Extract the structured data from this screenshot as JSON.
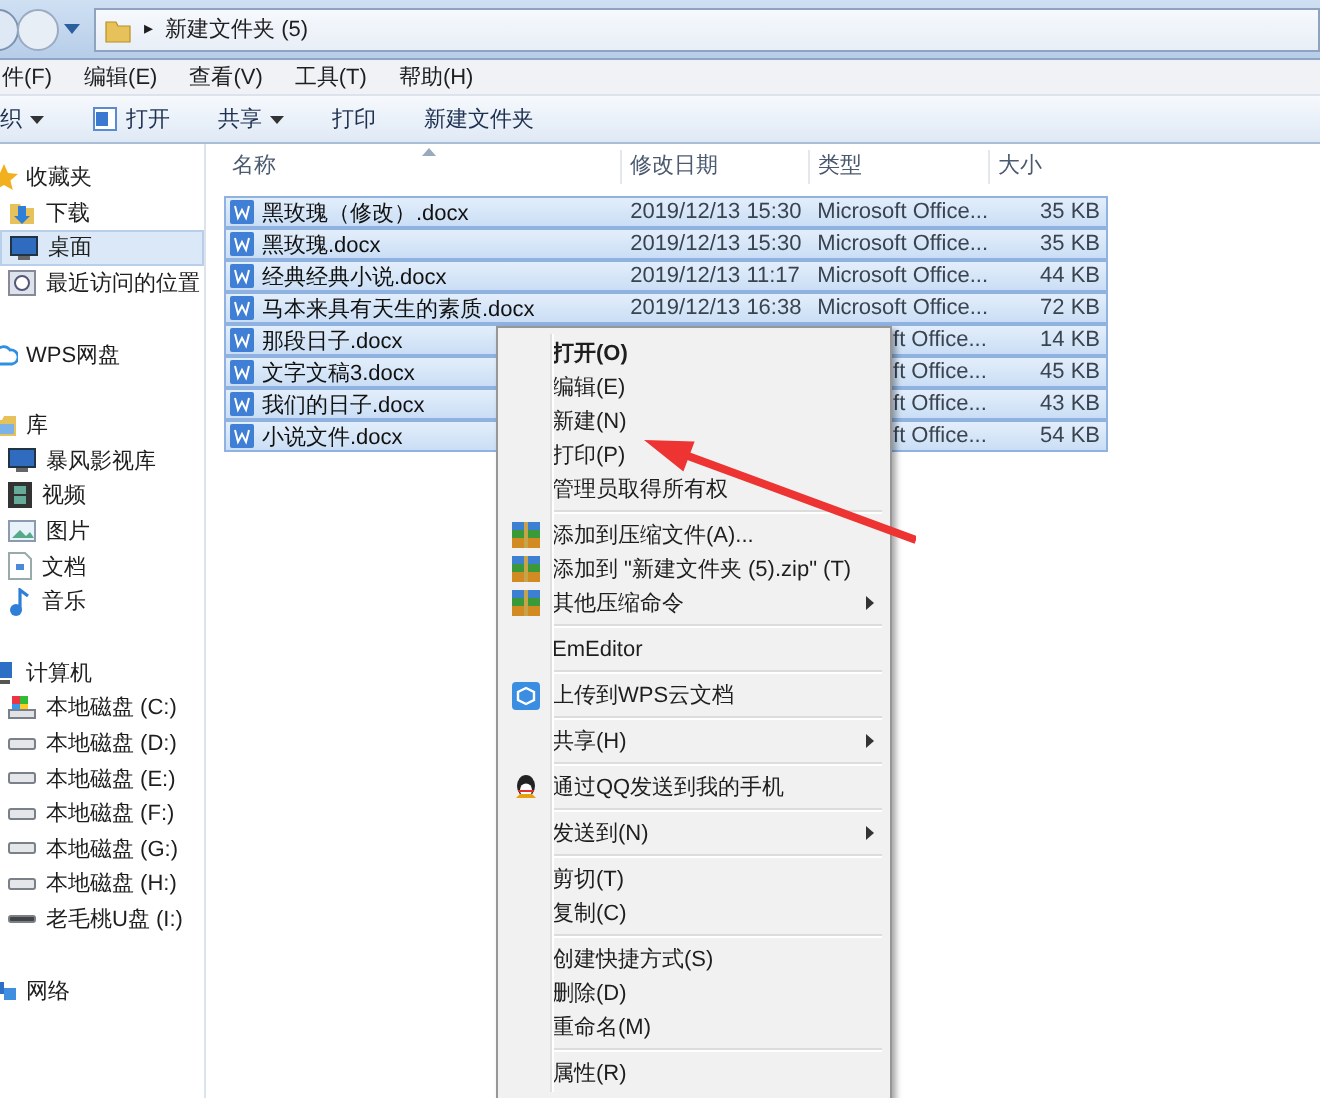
{
  "address_bar": {
    "separator": "▸",
    "path": "新建文件夹 (5)"
  },
  "menu_bar": [
    "件(F)",
    "编辑(E)",
    "查看(V)",
    "工具(T)",
    "帮助(H)"
  ],
  "toolbar": [
    {
      "label": "织",
      "dropdown": true
    },
    {
      "label": "打开",
      "dropdown": false
    },
    {
      "label": "共享",
      "dropdown": true
    },
    {
      "label": "打印",
      "dropdown": false
    },
    {
      "label": "新建文件夹",
      "dropdown": false
    }
  ],
  "sidebar": [
    {
      "label": "收藏夹",
      "children": [
        {
          "label": "下载",
          "selected": false
        },
        {
          "label": "桌面",
          "selected": true
        },
        {
          "label": "最近访问的位置",
          "selected": false
        }
      ]
    },
    {
      "label": "WPS网盘"
    },
    {
      "label": "库",
      "children": [
        {
          "label": "暴风影视库",
          "selected": false
        },
        {
          "label": "视频",
          "selected": false
        },
        {
          "label": "图片",
          "selected": false
        },
        {
          "label": "文档",
          "selected": false
        },
        {
          "label": "音乐",
          "selected": false
        }
      ]
    },
    {
      "label": "计算机",
      "children": [
        {
          "label": "本地磁盘 (C:)",
          "selected": false
        },
        {
          "label": "本地磁盘 (D:)",
          "selected": false
        },
        {
          "label": "本地磁盘 (E:)",
          "selected": false
        },
        {
          "label": "本地磁盘 (F:)",
          "selected": false
        },
        {
          "label": "本地磁盘 (G:)",
          "selected": false
        },
        {
          "label": "本地磁盘 (H:)",
          "selected": false
        },
        {
          "label": "老毛桃U盘 (I:)",
          "selected": false
        }
      ]
    },
    {
      "label": "网络"
    }
  ],
  "table": {
    "columns": [
      "名称",
      "修改日期",
      "类型",
      "大小"
    ],
    "rows": [
      {
        "name": "黑玫瑰（修改）.docx",
        "date": "2019/12/13 15:30",
        "type": "Microsoft Office...",
        "size": "35 KB",
        "selected": true
      },
      {
        "name": "黑玫瑰.docx",
        "date": "2019/12/13 15:30",
        "type": "Microsoft Office...",
        "size": "35 KB",
        "selected": true
      },
      {
        "name": "经典经典小说.docx",
        "date": "2019/12/13 11:17",
        "type": "Microsoft Office...",
        "size": "44 KB",
        "selected": true
      },
      {
        "name": "马本来具有天生的素质.docx",
        "date": "2019/12/13 16:38",
        "type": "Microsoft Office...",
        "size": "72 KB",
        "selected": true
      },
      {
        "name": "那段日子.docx",
        "type": "ft Office...",
        "size": "14 KB",
        "selected": true
      },
      {
        "name": "文字文稿3.docx",
        "type": "ft Office...",
        "size": "45 KB",
        "selected": true
      },
      {
        "name": "我们的日子.docx",
        "type": "ft Office...",
        "size": "43 KB",
        "selected": true
      },
      {
        "name": "小说文件.docx",
        "type": "ft Office...",
        "size": "54 KB",
        "selected": true
      }
    ]
  },
  "context_menu": [
    {
      "kind": "item",
      "label": "打开(O)",
      "default": true
    },
    {
      "kind": "item",
      "label": "编辑(E)"
    },
    {
      "kind": "item",
      "label": "新建(N)"
    },
    {
      "kind": "item",
      "label": "打印(P)"
    },
    {
      "kind": "item",
      "label": "管理员取得所有权"
    },
    {
      "kind": "separator"
    },
    {
      "kind": "item",
      "label": "添加到压缩文件(A)..."
    },
    {
      "kind": "item",
      "label": "添加到 \"新建文件夹 (5).zip\" (T)"
    },
    {
      "kind": "item",
      "label": "其他压缩命令",
      "submenu": true
    },
    {
      "kind": "separator"
    },
    {
      "kind": "item",
      "label": "EmEditor"
    },
    {
      "kind": "separator"
    },
    {
      "kind": "item",
      "label": "上传到WPS云文档"
    },
    {
      "kind": "separator"
    },
    {
      "kind": "item",
      "label": "共享(H)",
      "submenu": true
    },
    {
      "kind": "separator"
    },
    {
      "kind": "item",
      "label": "通过QQ发送到我的手机"
    },
    {
      "kind": "separator"
    },
    {
      "kind": "item",
      "label": "发送到(N)",
      "submenu": true
    },
    {
      "kind": "separator"
    },
    {
      "kind": "item",
      "label": "剪切(T)"
    },
    {
      "kind": "item",
      "label": "复制(C)"
    },
    {
      "kind": "separator"
    },
    {
      "kind": "item",
      "label": "创建快捷方式(S)"
    },
    {
      "kind": "item",
      "label": "删除(D)"
    },
    {
      "kind": "item",
      "label": "重命名(M)"
    },
    {
      "kind": "separator"
    },
    {
      "kind": "item",
      "label": "属性(R)"
    }
  ]
}
